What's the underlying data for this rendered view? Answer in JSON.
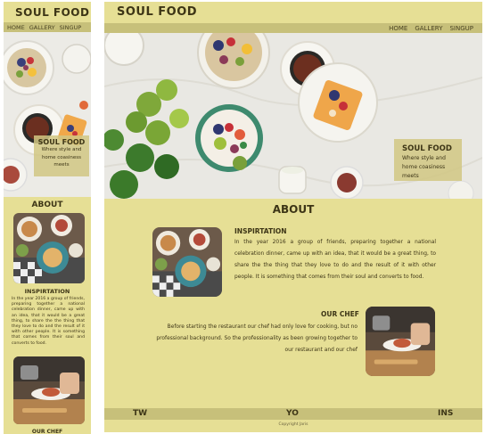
{
  "brand": {
    "title": "SOUL FOOD"
  },
  "nav": {
    "items": [
      "HOME",
      "GALLERY",
      "SINGUP"
    ]
  },
  "hero": {
    "title": "SOUL FOOD",
    "line1": "Where style and",
    "line2": "home coasiness",
    "line3": "meets"
  },
  "about": {
    "title": "ABOUT",
    "inspiration": {
      "heading": "INSPIRTATION",
      "text": "In the year 2016  a group of friends, preparing together a national celebration dinner, came up with an idea, that it would be a great thing, to share the the thing that they love to do and the result of it with other people. It is something that comes from  their soul and converts to food."
    },
    "chef": {
      "heading": "OUR CHEF",
      "text": "Before starting the restaurant our chef had only love for cooking, but no professional background. So the professionality as been growing together to our restaurant and our chef"
    }
  },
  "footer": {
    "social": [
      "TW",
      "YO",
      "INS"
    ],
    "copyright": "Copyright  Jaris"
  },
  "colors": {
    "panel": "#e6df95",
    "bar": "#c7c07a",
    "text": "#3d3516"
  }
}
